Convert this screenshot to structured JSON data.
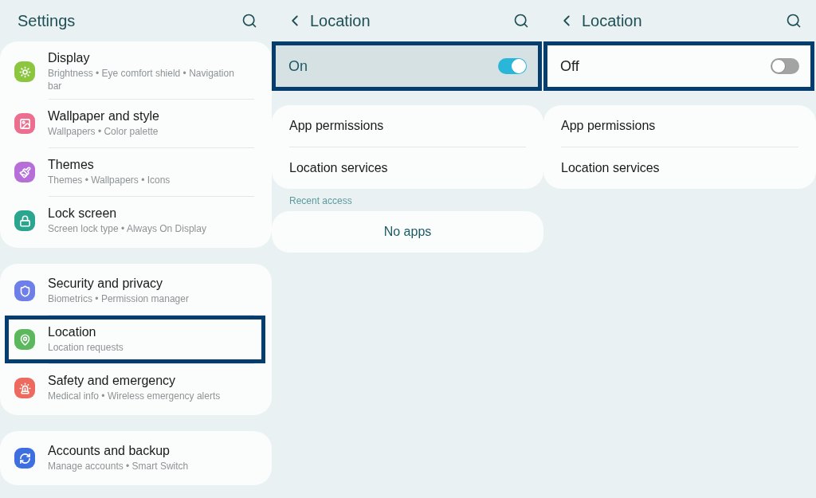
{
  "settings": {
    "title": "Settings",
    "groups": [
      {
        "items": [
          {
            "title": "Display",
            "subtitle": "Brightness • Eye comfort shield • Navigation bar",
            "color": "#8cc63f",
            "highlighted": false
          },
          {
            "title": "Wallpaper and style",
            "subtitle": "Wallpapers • Color palette",
            "color": "#ec6f8f",
            "highlighted": false
          },
          {
            "title": "Themes",
            "subtitle": "Themes • Wallpapers • Icons",
            "color": "#b66fd8",
            "highlighted": false
          },
          {
            "title": "Lock screen",
            "subtitle": "Screen lock type • Always On Display",
            "color": "#2aa58e",
            "highlighted": false
          }
        ]
      },
      {
        "items": [
          {
            "title": "Security and privacy",
            "subtitle": "Biometrics • Permission manager",
            "color": "#6f7fe8",
            "highlighted": false
          },
          {
            "title": "Location",
            "subtitle": "Location requests",
            "color": "#5cb85c",
            "highlighted": true
          },
          {
            "title": "Safety and emergency",
            "subtitle": "Medical info • Wireless emergency alerts",
            "color": "#ec6a5e",
            "highlighted": false
          }
        ]
      },
      {
        "items": [
          {
            "title": "Accounts and backup",
            "subtitle": "Manage accounts • Smart Switch",
            "color": "#3e6fe0",
            "highlighted": false
          }
        ]
      }
    ]
  },
  "location_screens": [
    {
      "title": "Location",
      "toggle": {
        "label": "On",
        "on": true,
        "highlighted": true
      },
      "menu": [
        "App permissions",
        "Location services"
      ],
      "recent_access": {
        "heading": "Recent access",
        "empty_text": "No apps"
      }
    },
    {
      "title": "Location",
      "toggle": {
        "label": "Off",
        "on": false,
        "highlighted": true
      },
      "menu": [
        "App permissions",
        "Location services"
      ]
    }
  ]
}
